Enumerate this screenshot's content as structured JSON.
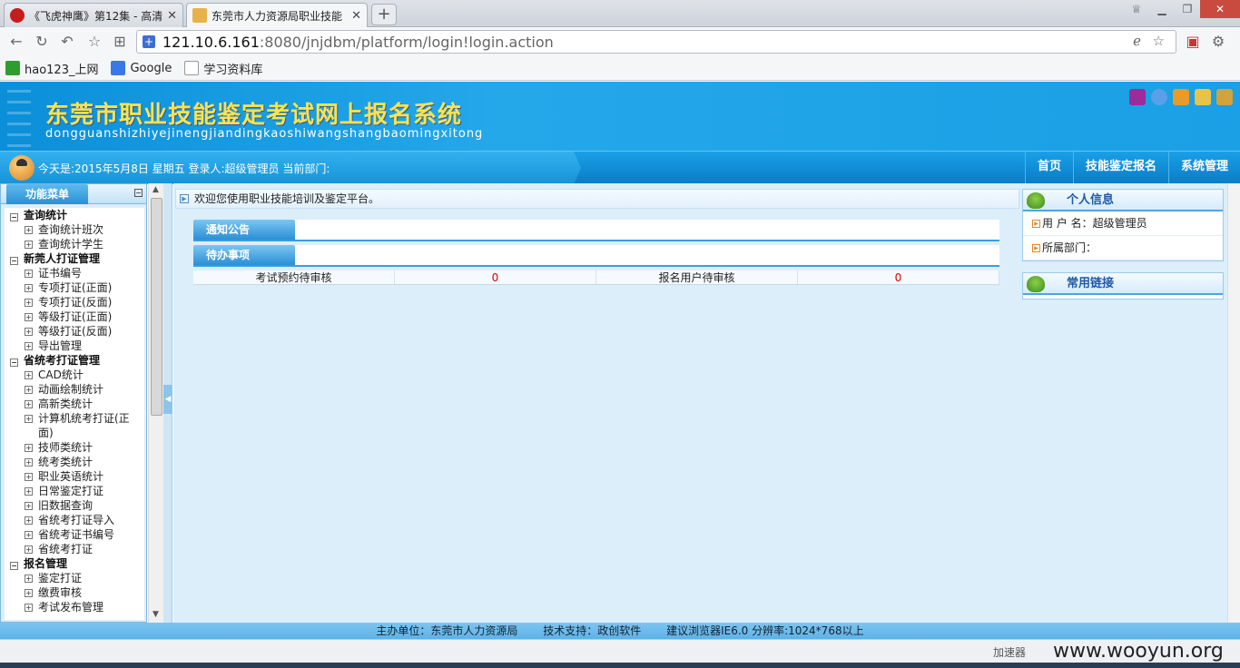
{
  "browser": {
    "tabs": [
      {
        "title": "《飞虎神鹰》第12集 - 高清",
        "active": false
      },
      {
        "title": "东莞市人力资源局职业技能",
        "active": true
      }
    ],
    "new_tab": "+",
    "url_host": "121.10.6.161",
    "url_path": ":8080/jnjdbm/platform/login!login.action",
    "bookmarks": [
      "hao123_上网",
      "Google",
      "学习资料库"
    ]
  },
  "header": {
    "title": "东莞市职业技能鉴定考试网上报名系统",
    "subtitle": "dongguanshizhiyejinengjiandingkaoshiwangshangbaomingxitong"
  },
  "infobar": {
    "status": "今天是:2015年5月8日  星期五  登录人:超级管理员  当前部门:"
  },
  "topnav": [
    "首页",
    "技能鉴定报名",
    "系统管理"
  ],
  "sidebar": {
    "title": "功能菜单",
    "groups": [
      {
        "label": "查询统计",
        "items": [
          "查询统计班次",
          "查询统计学生"
        ]
      },
      {
        "label": "新莞人打证管理",
        "items": [
          "证书编号",
          "专项打证(正面)",
          "专项打证(反面)",
          "等级打证(正面)",
          "等级打证(反面)",
          "导出管理"
        ]
      },
      {
        "label": "省统考打证管理",
        "items": [
          "CAD统计",
          "动画绘制统计",
          "高新类统计",
          "计算机统考打证(正面)",
          "技师类统计",
          "统考类统计",
          "职业英语统计",
          "日常鉴定打证",
          "旧数据查询",
          "省统考打证导入",
          "省统考证书编号",
          "省统考打证"
        ]
      },
      {
        "label": "报名管理",
        "items": [
          "鉴定打证",
          "缴费审核",
          "考试发布管理"
        ]
      }
    ]
  },
  "main": {
    "welcome": "欢迎您使用职业技能培训及鉴定平台。",
    "notice_label": "通知公告",
    "todo_label": "待办事项",
    "todo_row": {
      "exam_label": "考试预约待审核",
      "exam_count": "0",
      "reg_label": "报名用户待审核",
      "reg_count": "0"
    }
  },
  "right": {
    "personal_title": "个人信息",
    "username_label": "用 户 名：",
    "username_value": "超级管理员",
    "dept_label": "所属部门：",
    "dept_value": "",
    "links_title": "常用链接"
  },
  "footer": {
    "host": "主办单位：东莞市人力资源局",
    "support": "技术支持：政创软件",
    "browser_hint": "建议浏览器IE6.0 分辨率:1024*768以上"
  },
  "statusbar": {
    "accelerator": "加速器",
    "watermark": "www.wooyun.org"
  }
}
